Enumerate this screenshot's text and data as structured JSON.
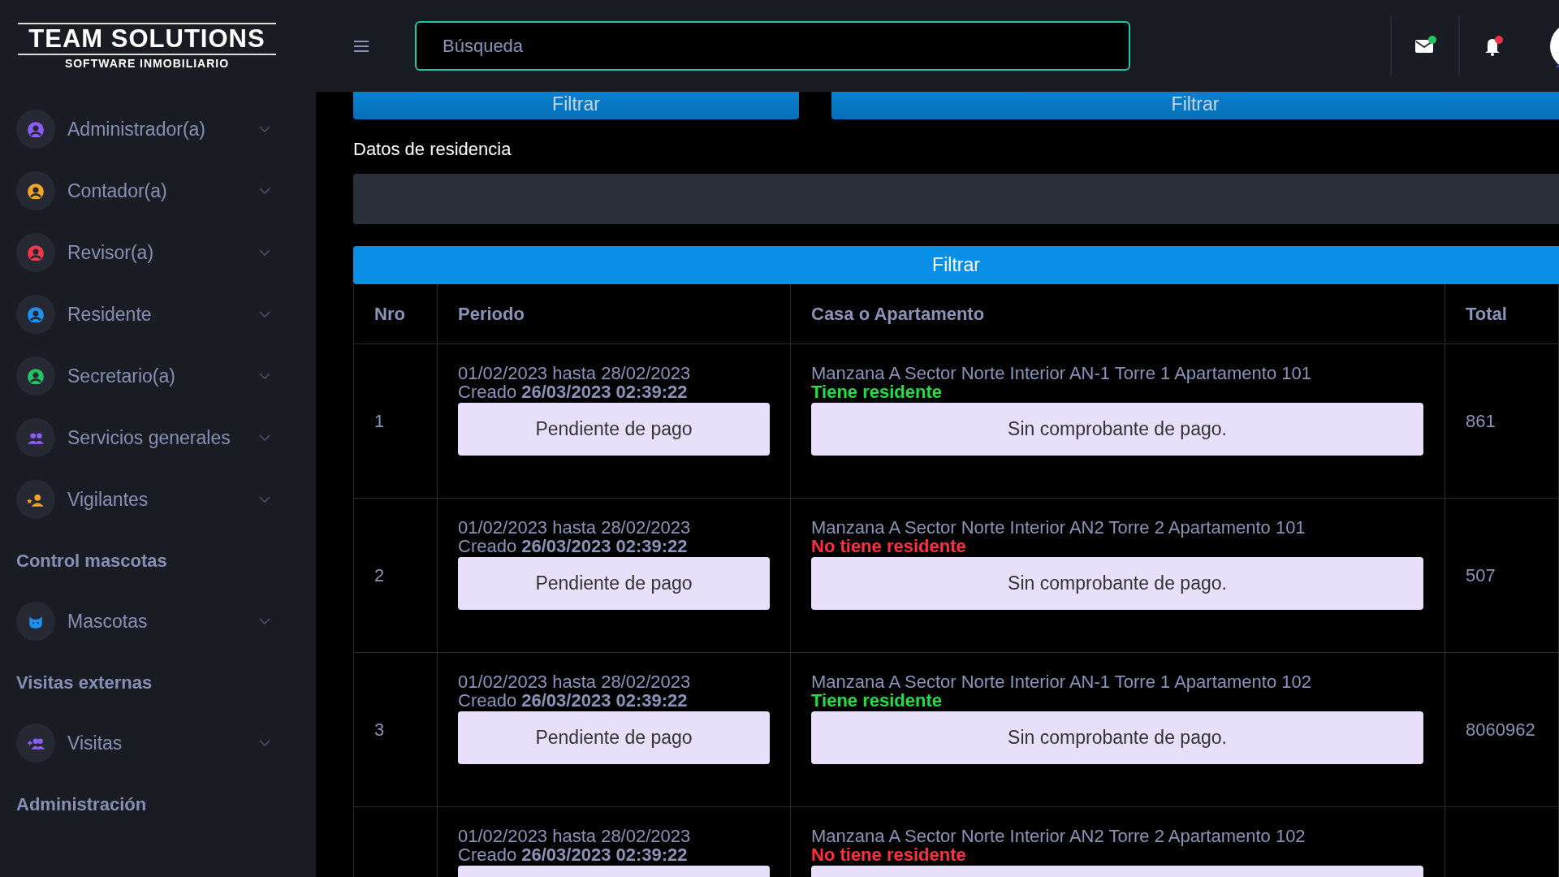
{
  "logo": {
    "title": "TEAM SOLUTIONS",
    "subtitle": "SOFTWARE INMOBILIARIO"
  },
  "search": {
    "placeholder": "Búsqueda"
  },
  "header_icons": [
    {
      "kind": "mail",
      "color": "#22c55e"
    },
    {
      "kind": "bell",
      "color": "#ef3346"
    }
  ],
  "sidebar": [
    {
      "kind": "person",
      "color": "#8b5cf6",
      "label": "Administrador(a)"
    },
    {
      "kind": "person",
      "color": "#f5a524",
      "label": "Contador(a)"
    },
    {
      "kind": "person",
      "color": "#f0384b",
      "label": "Revisor(a)"
    },
    {
      "kind": "person",
      "color": "#1e90ef",
      "label": "Residente"
    },
    {
      "kind": "person",
      "color": "#22c55e",
      "label": "Secretario(a)"
    },
    {
      "kind": "group",
      "color": "#8b5cf6",
      "label": "Servicios generales"
    },
    {
      "kind": "guard",
      "color": "#f5a524",
      "label": "Vigilantes"
    },
    {
      "kind": "section",
      "label": "Control mascotas"
    },
    {
      "kind": "pet",
      "color": "#1e90ef",
      "label": "Mascotas"
    },
    {
      "kind": "section",
      "label": "Visitas externas"
    },
    {
      "kind": "group-add",
      "color": "#8b5cf6",
      "label": "Visitas"
    },
    {
      "kind": "section",
      "label": "Administración"
    }
  ],
  "top_buttons": [
    "Filtrar",
    "Filtrar"
  ],
  "residence": {
    "label": "Datos de residencia"
  },
  "filter_button": "Filtrar",
  "table": {
    "columns": [
      "Nro",
      "Periodo",
      "Casa o Apartamento",
      "Total"
    ],
    "rows": [
      {
        "nro": "1",
        "period": "01/02/2023 hasta 28/02/2023",
        "created": "Creado **26/03/2023 02:39:22**",
        "status_button": "Pendiente de pago",
        "unit": "Manzana A Sector Norte Interior AN-1 Torre 1 Apartamento 101",
        "resident": {
          "text": "Tiene residente",
          "color": "#22dd44"
        },
        "receipt_button": "Sin comprobante de pago.",
        "total": "861"
      },
      {
        "nro": "2",
        "period": "01/02/2023 hasta 28/02/2023",
        "created": "Creado **26/03/2023 02:39:22**",
        "status_button": "Pendiente de pago",
        "unit": "Manzana A Sector Norte Interior AN2 Torre 2 Apartamento 101",
        "resident": {
          "text": "No tiene residente",
          "color": "#ff2f3f"
        },
        "receipt_button": "Sin comprobante de pago.",
        "total": "507"
      },
      {
        "nro": "3",
        "period": "01/02/2023 hasta 28/02/2023",
        "created": "Creado **26/03/2023 02:39:22**",
        "status_button": "Pendiente de pago",
        "unit": "Manzana A Sector Norte Interior AN-1 Torre 1 Apartamento 102",
        "resident": {
          "text": "Tiene residente",
          "color": "#22dd44"
        },
        "receipt_button": "Sin comprobante de pago.",
        "total": "8060962"
      },
      {
        "period": "01/02/2023 hasta 28/02/2023",
        "created": "Creado **26/03/2023 02:39:22**",
        "unit": "Manzana A Sector Norte Interior AN2 Torre 2 Apartamento 102",
        "resident": {
          "text": "No tiene residente",
          "color": "#ff2f3f"
        }
      }
    ]
  }
}
